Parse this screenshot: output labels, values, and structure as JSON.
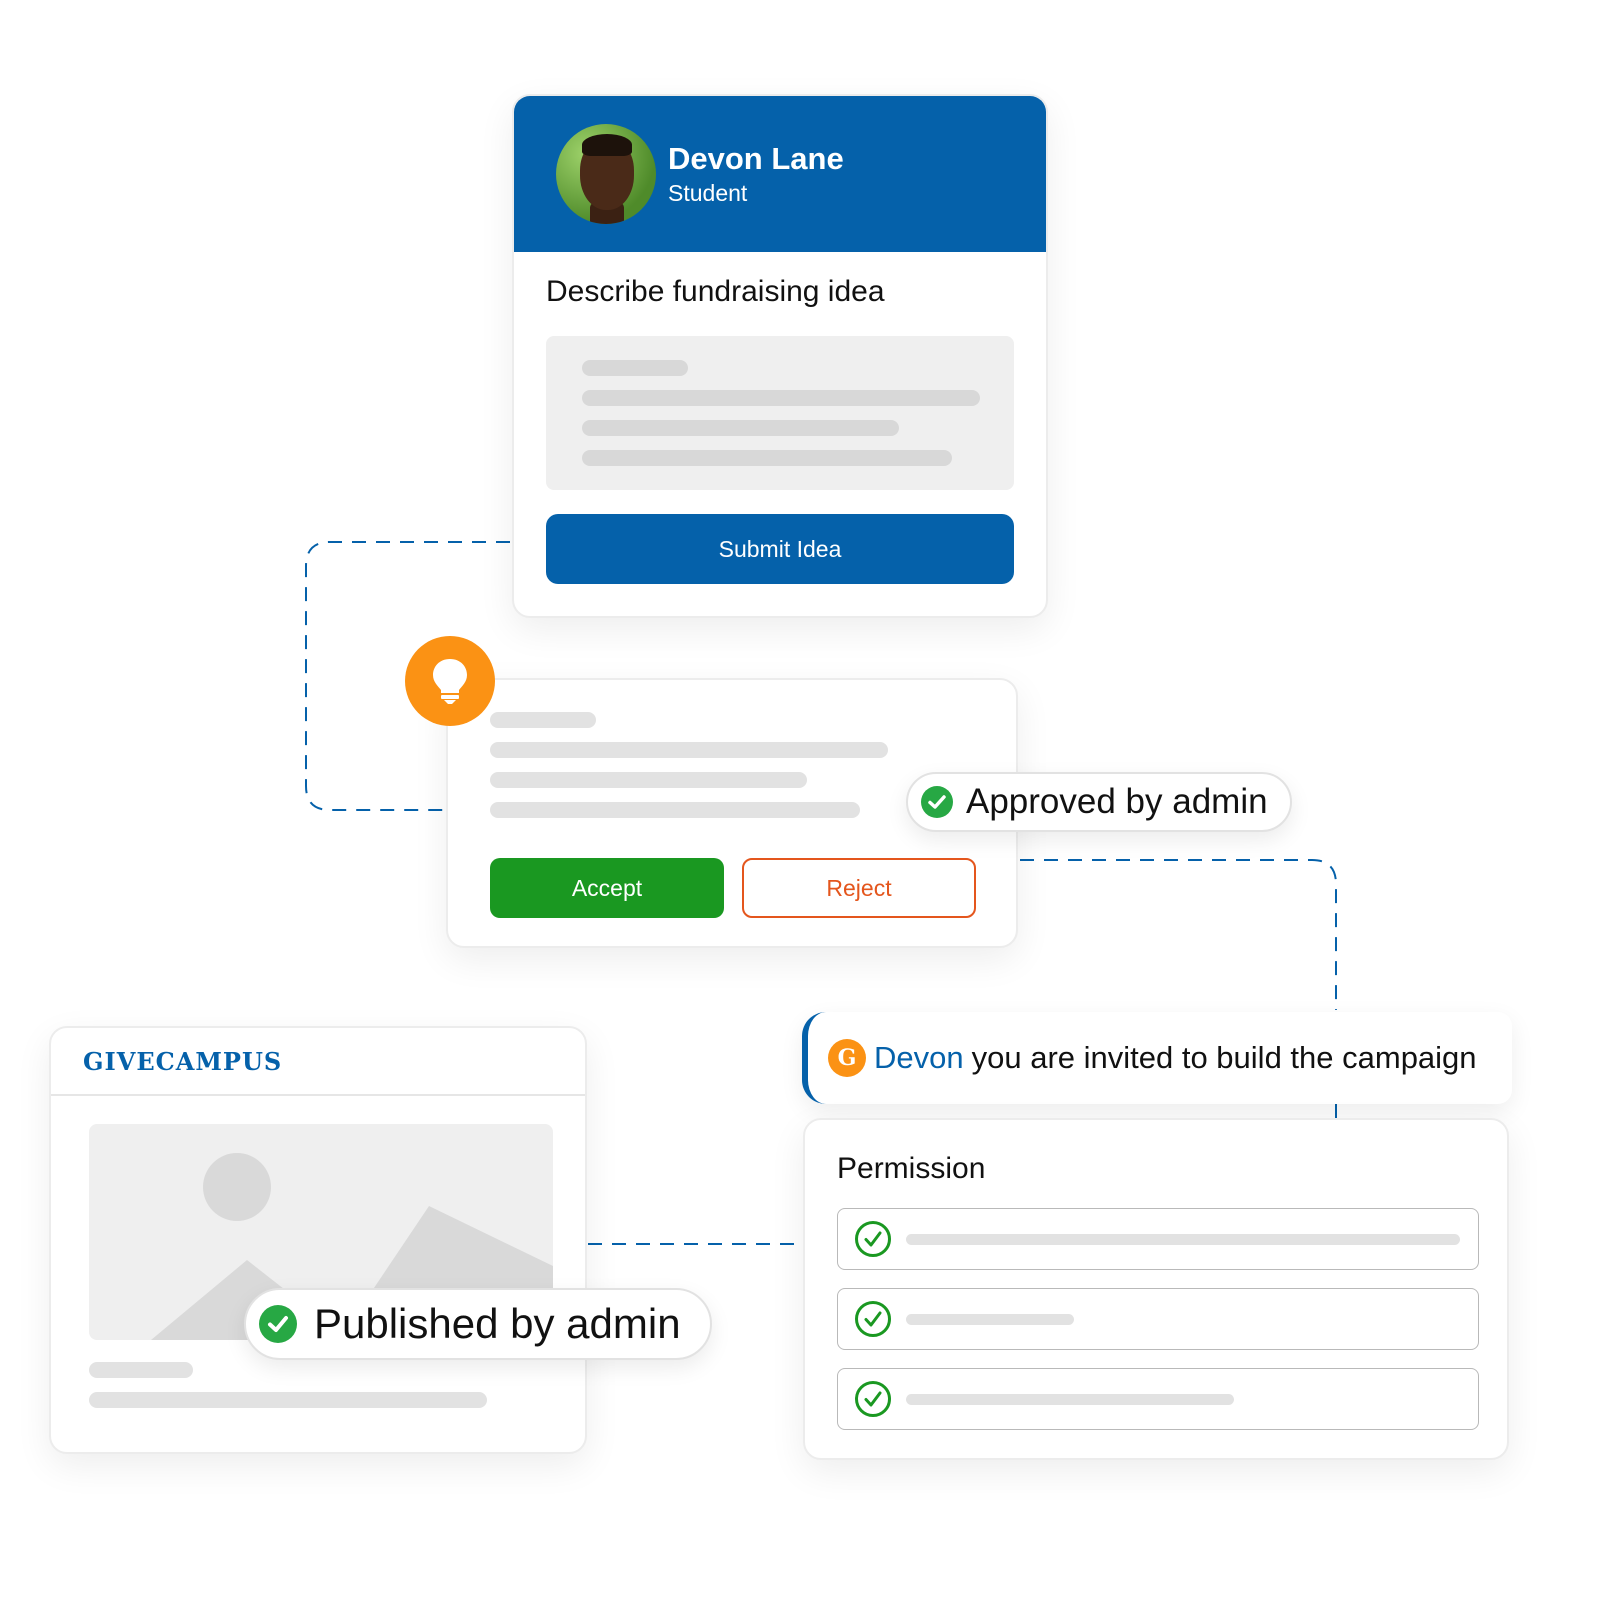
{
  "colors": {
    "accent": "#0561aa",
    "accept": "#1a9821",
    "reject": "#e4561d",
    "highlight": "#fb9214",
    "check": "#27a844"
  },
  "profile": {
    "name": "Devon Lane",
    "role": "Student",
    "avatar_icon": "person-photo",
    "form_title": "Describe fundraising idea",
    "submit_label": "Submit Idea"
  },
  "review": {
    "icon": "lightbulb-icon",
    "accept_label": "Accept",
    "reject_label": "Reject"
  },
  "approved_badge": {
    "icon": "check-circle-icon",
    "text": "Approved by admin"
  },
  "invite": {
    "logo_letter": "G",
    "name": "Devon",
    "message": "you are invited to build the campaign"
  },
  "permission": {
    "title": "Permission",
    "items": [
      {
        "icon": "check-circle-outline-icon",
        "checked": true
      },
      {
        "icon": "check-circle-outline-icon",
        "checked": true
      },
      {
        "icon": "check-circle-outline-icon",
        "checked": true
      }
    ]
  },
  "campaign": {
    "brand": "GIVECAMPUS",
    "image_icon": "image-placeholder-icon"
  },
  "published_badge": {
    "icon": "check-circle-icon",
    "text": "Published by admin"
  }
}
